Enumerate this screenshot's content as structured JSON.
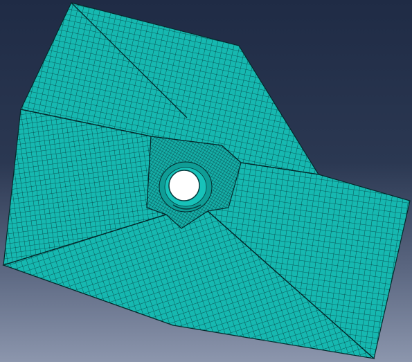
{
  "viewport": {
    "background_top": "#1f2b45",
    "background_bottom": "#8c96ad"
  },
  "mesh": {
    "fill_color": "#16b8b0",
    "line_color": "#063a3c",
    "edge_color": "#04282a",
    "hole_fill": "#ffffff",
    "hole_ring_color": "#0fa9a1",
    "parts": [
      "upper-face",
      "left-face",
      "bottom-face",
      "right-face",
      "center-block",
      "borehole"
    ]
  }
}
